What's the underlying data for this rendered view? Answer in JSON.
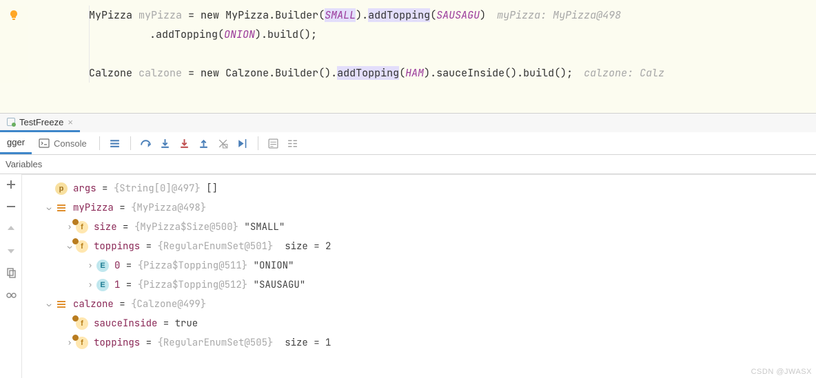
{
  "editor": {
    "lines": {
      "l1_a": "MyPizza ",
      "l1_b": "myPizza",
      "l1_c": " = ",
      "l1_d": "new",
      "l1_e": " MyPizza.Builder(",
      "l1_f": "SMALL",
      "l1_g": ").",
      "l1_h": "addTopping",
      "l1_i": "(",
      "l1_j": "SAUSAGU",
      "l1_k": ")",
      "l1_hint": "myPizza: MyPizza@498",
      "l2_a": ".addTopping(",
      "l2_b": "ONION",
      "l2_c": ").build();",
      "l4_a": "Calzone ",
      "l4_b": "calzone",
      "l4_c": " = ",
      "l4_d": "new",
      "l4_e": " Calzone.Builder().",
      "l4_f": "addTopping",
      "l4_g": "(",
      "l4_h": "HAM",
      "l4_i": ").sauceInside().build();",
      "l4_hint": "calzone: Calz"
    }
  },
  "tab": {
    "name": "TestFreeze"
  },
  "toolbar": {
    "debugger": "gger",
    "console": "Console",
    "variables": "Variables"
  },
  "vars": {
    "args": {
      "name": "args",
      "eq": " = ",
      "ref": "{String[0]@497} ",
      "val": "[]"
    },
    "myPizza": {
      "name": "myPizza",
      "eq": " = ",
      "ref": "{MyPizza@498}"
    },
    "size": {
      "name": "size",
      "eq": " = ",
      "ref": "{MyPizza$Size@500} ",
      "val": "\"SMALL\""
    },
    "toppings": {
      "name": "toppings",
      "eq": " = ",
      "ref": "{RegularEnumSet@501}  ",
      "val": "size = 2"
    },
    "t0": {
      "name": "0",
      "eq": " = ",
      "ref": "{Pizza$Topping@511} ",
      "val": "\"ONION\""
    },
    "t1": {
      "name": "1",
      "eq": " = ",
      "ref": "{Pizza$Topping@512} ",
      "val": "\"SAUSAGU\""
    },
    "calzone": {
      "name": "calzone",
      "eq": " = ",
      "ref": "{Calzone@499}"
    },
    "sauceInside": {
      "name": "sauceInside",
      "eq": " = ",
      "val": "true"
    },
    "toppings2": {
      "name": "toppings",
      "eq": " = ",
      "ref": "{RegularEnumSet@505}  ",
      "val": "size = 1"
    }
  },
  "watermark": "CSDN @JWASX"
}
